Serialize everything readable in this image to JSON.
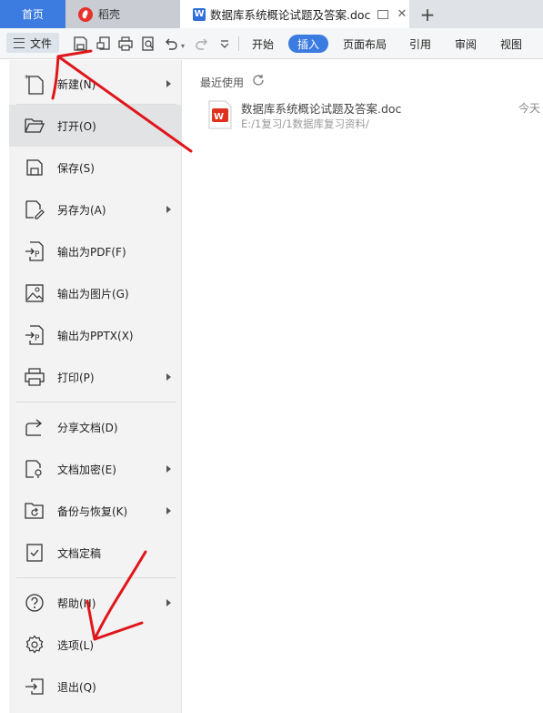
{
  "tabs": {
    "home": "首页",
    "daoke": "稻壳",
    "doc": "数据库系统概论试题及答案.doc"
  },
  "toolbar": {
    "file_label": "文件",
    "ribbon": [
      "开始",
      "插入",
      "页面布局",
      "引用",
      "审阅",
      "视图"
    ],
    "active_ribbon": "插入"
  },
  "menu": {
    "items": [
      {
        "label": "新建(N)",
        "icon": "new-file-icon",
        "submenu": true
      },
      {
        "label": "打开(O)",
        "icon": "folder-open-icon",
        "submenu": false,
        "active": true
      },
      {
        "label": "保存(S)",
        "icon": "save-icon",
        "submenu": false
      },
      {
        "label": "另存为(A)",
        "icon": "save-as-icon",
        "submenu": true
      },
      {
        "label": "输出为PDF(F)",
        "icon": "export-pdf-icon",
        "submenu": false
      },
      {
        "label": "输出为图片(G)",
        "icon": "export-image-icon",
        "submenu": false
      },
      {
        "label": "输出为PPTX(X)",
        "icon": "export-pptx-icon",
        "submenu": false
      },
      {
        "label": "打印(P)",
        "icon": "print-icon",
        "submenu": true
      },
      {
        "label": "分享文档(D)",
        "icon": "share-icon",
        "submenu": false
      },
      {
        "label": "文档加密(E)",
        "icon": "encrypt-icon",
        "submenu": true
      },
      {
        "label": "备份与恢复(K)",
        "icon": "backup-icon",
        "submenu": true
      },
      {
        "label": "文档定稿",
        "icon": "finalize-icon",
        "submenu": false
      },
      {
        "label": "帮助(H)",
        "icon": "help-icon",
        "submenu": true
      },
      {
        "label": "选项(L)",
        "icon": "gear-icon",
        "submenu": false
      },
      {
        "label": "退出(Q)",
        "icon": "exit-icon",
        "submenu": false
      }
    ]
  },
  "recent": {
    "title": "最近使用",
    "files": [
      {
        "name": "数据库系统概论试题及答案.doc",
        "path": "E:/1复习/1数据库复习资料/",
        "time": "今天"
      }
    ]
  },
  "colors": {
    "accent": "#3c7be0",
    "annotation": "#e0161b"
  }
}
